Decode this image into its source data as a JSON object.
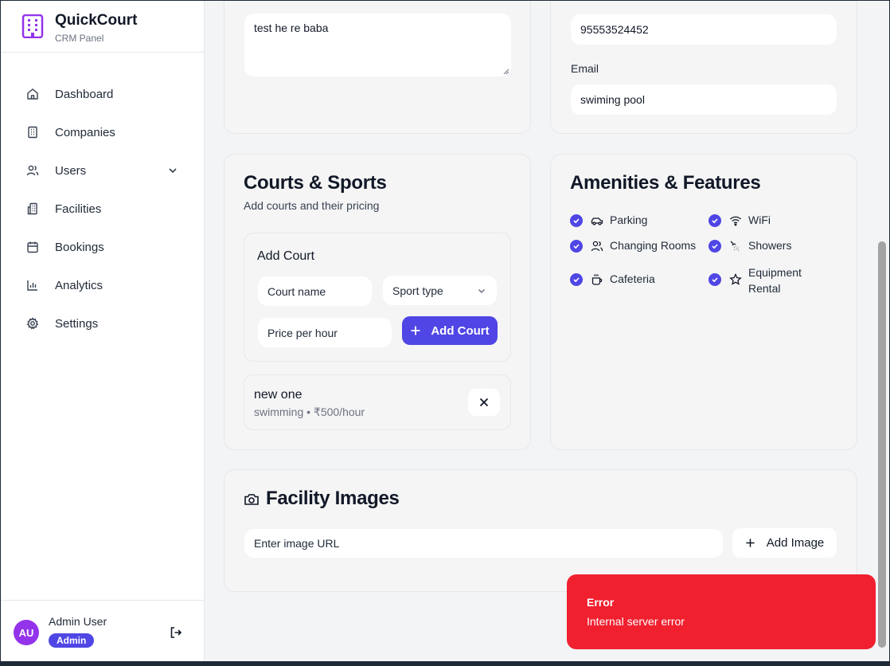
{
  "brand": {
    "name": "QuickCourt",
    "subtitle": "CRM Panel"
  },
  "nav": {
    "items": [
      {
        "label": "Dashboard",
        "icon": "home-icon"
      },
      {
        "label": "Companies",
        "icon": "building-icon"
      },
      {
        "label": "Users",
        "icon": "users-icon",
        "expandable": true
      },
      {
        "label": "Facilities",
        "icon": "facility-icon"
      },
      {
        "label": "Bookings",
        "icon": "calendar-icon"
      },
      {
        "label": "Analytics",
        "icon": "chart-icon"
      },
      {
        "label": "Settings",
        "icon": "gear-icon"
      }
    ]
  },
  "user": {
    "initials": "AU",
    "name": "Admin User",
    "role": "Admin"
  },
  "basic": {
    "description_value": "test he re baba"
  },
  "contact": {
    "phone_value": "95553524452",
    "email_label": "Email",
    "email_value": "swiming pool"
  },
  "courts": {
    "title": "Courts & Sports",
    "subtitle": "Add courts and their pricing",
    "add_title": "Add Court",
    "court_name_placeholder": "Court name",
    "sport_type_placeholder": "Sport type",
    "price_placeholder": "Price per hour",
    "add_button": "Add Court",
    "list": [
      {
        "name": "new one",
        "detail": "swimming • ₹500/hour"
      }
    ]
  },
  "amenities": {
    "title": "Amenities & Features",
    "items": [
      {
        "label": "Parking",
        "icon": "car-icon",
        "checked": true
      },
      {
        "label": "WiFi",
        "icon": "wifi-icon",
        "checked": true
      },
      {
        "label": "Changing Rooms",
        "icon": "users-icon",
        "checked": true
      },
      {
        "label": "Showers",
        "icon": "shower-icon",
        "checked": true
      },
      {
        "label": "Cafeteria",
        "icon": "coffee-icon",
        "checked": true
      },
      {
        "label": "Equipment Rental",
        "icon": "star-icon",
        "checked": true
      }
    ]
  },
  "images": {
    "title": "Facility Images",
    "url_placeholder": "Enter image URL",
    "add_button": "Add Image"
  },
  "toast": {
    "title": "Error",
    "message": "Internal server error"
  },
  "colors": {
    "accent": "#4f46e5",
    "brand": "#9333ea",
    "error": "#f0202f"
  }
}
